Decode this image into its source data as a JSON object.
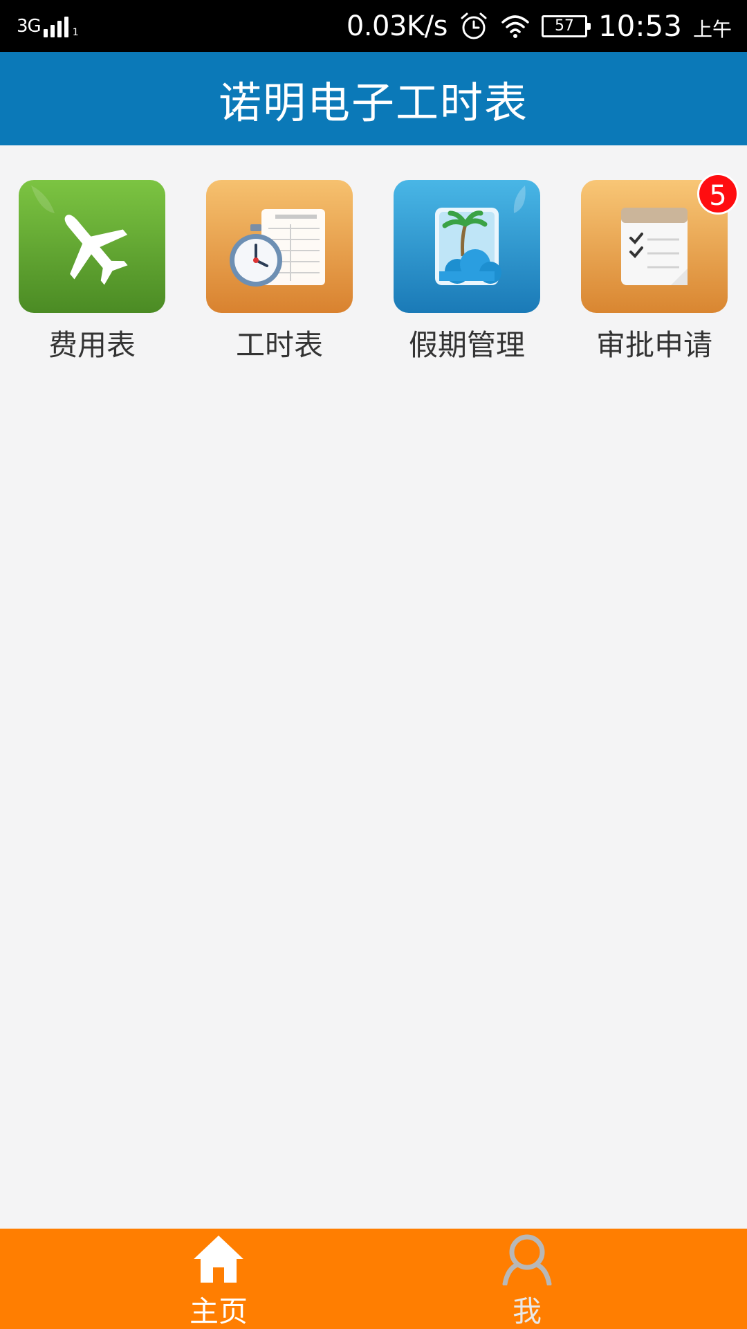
{
  "status_bar": {
    "network": "3G",
    "sim_slot": "1",
    "speed": "0.03K/s",
    "battery": "57",
    "time": "10:53",
    "ampm": "上午",
    "icons": [
      "signal-icon",
      "alarm-clock-icon",
      "wifi-icon",
      "battery-icon"
    ]
  },
  "header": {
    "title": "诺明电子工时表"
  },
  "apps": [
    {
      "label": "费用表",
      "icon": "airplane-icon",
      "color": "#5fa933"
    },
    {
      "label": "工时表",
      "icon": "stopwatch-timesheet-icon",
      "color": "#e59a45"
    },
    {
      "label": "假期管理",
      "icon": "palm-tree-beach-icon",
      "color": "#2d92cc"
    },
    {
      "label": "审批申请",
      "icon": "checklist-notepad-icon",
      "color": "#e99d48",
      "badge": "5"
    }
  ],
  "bottom_nav": {
    "home_label": "主页",
    "me_label": "我",
    "active": "主页",
    "bg_color": "#ff7e01"
  }
}
